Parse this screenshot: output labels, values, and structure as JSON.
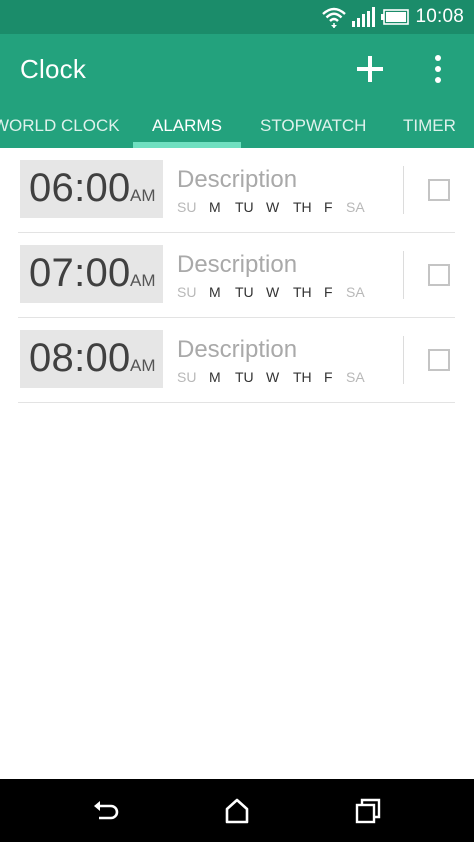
{
  "status_bar": {
    "time": "10:08"
  },
  "app_bar": {
    "title": "Clock",
    "add_icon": "plus-icon",
    "more_icon": "more-vert-icon"
  },
  "tabs": [
    {
      "label": "WORLD CLOCK",
      "active": false
    },
    {
      "label": "ALARMS",
      "active": true
    },
    {
      "label": "STOPWATCH",
      "active": false
    },
    {
      "label": "TIMER",
      "active": false
    }
  ],
  "alarms": [
    {
      "time": "06:00",
      "ampm": "AM",
      "description": "Description",
      "checked": false,
      "days": [
        {
          "label": "SU",
          "on": false
        },
        {
          "label": "M",
          "on": true
        },
        {
          "label": "TU",
          "on": true
        },
        {
          "label": "W",
          "on": true
        },
        {
          "label": "TH",
          "on": true
        },
        {
          "label": "F",
          "on": true
        },
        {
          "label": "SA",
          "on": false
        }
      ]
    },
    {
      "time": "07:00",
      "ampm": "AM",
      "description": "Description",
      "checked": false,
      "days": [
        {
          "label": "SU",
          "on": false
        },
        {
          "label": "M",
          "on": true
        },
        {
          "label": "TU",
          "on": true
        },
        {
          "label": "W",
          "on": true
        },
        {
          "label": "TH",
          "on": true
        },
        {
          "label": "F",
          "on": true
        },
        {
          "label": "SA",
          "on": false
        }
      ]
    },
    {
      "time": "08:00",
      "ampm": "AM",
      "description": "Description",
      "checked": false,
      "days": [
        {
          "label": "SU",
          "on": false
        },
        {
          "label": "M",
          "on": true
        },
        {
          "label": "TU",
          "on": true
        },
        {
          "label": "W",
          "on": true
        },
        {
          "label": "TH",
          "on": true
        },
        {
          "label": "F",
          "on": true
        },
        {
          "label": "SA",
          "on": false
        }
      ]
    }
  ],
  "nav_bar": {
    "back_icon": "back-icon",
    "home_icon": "home-icon",
    "recents_icon": "recents-icon"
  },
  "colors": {
    "status_bar": "#1b8c6a",
    "app_bar": "#23a27d",
    "tab_indicator": "#6fe0c0"
  }
}
